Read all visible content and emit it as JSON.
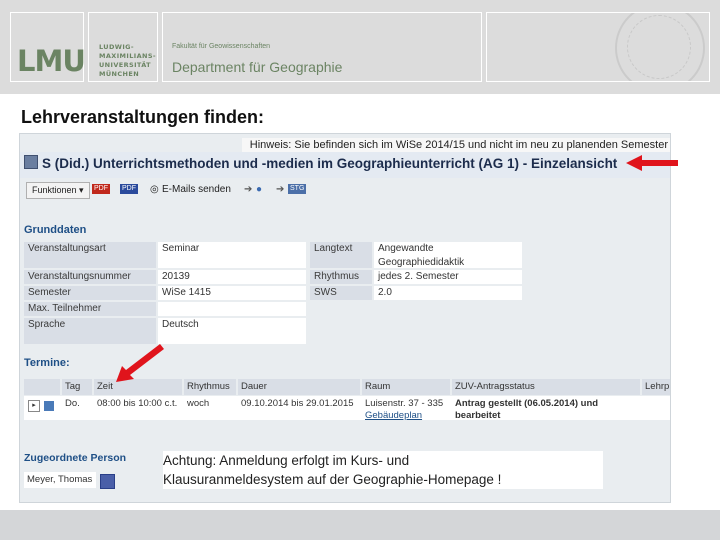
{
  "header": {
    "logo_text": "LMU",
    "university_lines": [
      "LUDWIG-",
      "MAXIMILIANS-",
      "UNIVERSITÄT",
      "MÜNCHEN"
    ],
    "faculty": "Fakultät für Geowissenschaften",
    "department": "Department für Geographie"
  },
  "slide_title": "Lehrveranstaltungen finden:",
  "screenshot": {
    "hint": "Hinweis: Sie befinden sich im WiSe 2014/15 und nicht im neu zu planenden Semester",
    "course_title": "S (Did.) Unterrichtsmethoden und -medien im Geographieunterricht (AG 1) - Einzelansicht",
    "toolbar": {
      "functions_label": "Funktionen",
      "pdf1": "PDF",
      "pdf2": "PDF",
      "email_label": "E-Mails senden",
      "stg": "STG"
    },
    "grunddaten": {
      "heading": "Grunddaten",
      "rows": [
        {
          "label": "Veranstaltungsart",
          "value": "Seminar",
          "label2": "Langtext",
          "value2": "Angewandte Geographiedidaktik"
        },
        {
          "label": "Veranstaltungsnummer",
          "value": "20139",
          "label2": "Rhythmus",
          "value2": "jedes 2. Semester"
        },
        {
          "label": "Semester",
          "value": "WiSe 1415",
          "label2": "SWS",
          "value2": "2.0"
        },
        {
          "label": "Max. Teilnehmer",
          "value": ""
        },
        {
          "label": "Sprache",
          "value": "Deutsch"
        }
      ]
    },
    "termine": {
      "heading": "Termine:",
      "columns": [
        "Tag",
        "Zeit",
        "Rhythmus",
        "Dauer",
        "Raum",
        "ZUV-Antragsstatus",
        "Lehrp"
      ],
      "row": {
        "tag": "Do.",
        "zeit": "08:00 bis 10:00 c.t.",
        "rhythmus": "woch",
        "dauer": "09.10.2014 bis 29.01.2015",
        "raum": "Luisenstr. 37 - 335",
        "raum_link": "Gebäudeplan",
        "status": "Antrag gestellt (06.05.2014) und bearbeitet"
      }
    },
    "person": {
      "heading": "Zugeordnete Person",
      "name": "Meyer, Thomas"
    }
  },
  "callout": {
    "line1": "Achtung: Anmeldung erfolgt im Kurs- und",
    "line2": "Klausuranmeldesystem auf der Geographie-Homepage !"
  },
  "colors": {
    "header_bg": "#dcdcdc",
    "lmu_green": "#6b8463",
    "arrow_red": "#e0141c",
    "section_blue": "#1e4f86"
  }
}
